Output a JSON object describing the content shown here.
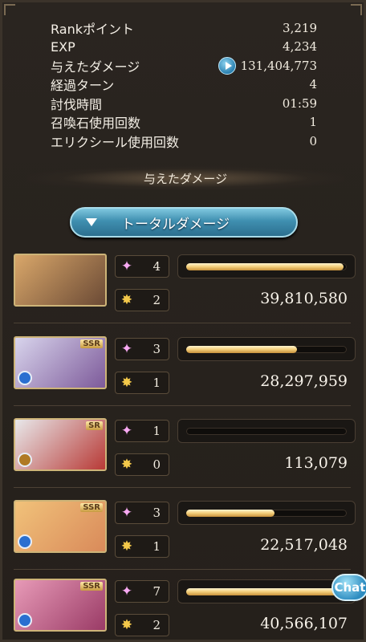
{
  "stats": [
    {
      "label": "Rankポイント",
      "value": "3,219"
    },
    {
      "label": "EXP",
      "value": "4,234"
    },
    {
      "label": "与えたダメージ",
      "value": "131,404,773",
      "has_button": true
    },
    {
      "label": "経過ターン",
      "value": "4"
    },
    {
      "label": "討伐時間",
      "value": "01:59"
    },
    {
      "label": "召喚石使用回数",
      "value": "1"
    },
    {
      "label": "エリクシール使用回数",
      "value": "0"
    }
  ],
  "section_title": "与えたダメージ",
  "dropdown_label": "トータルダメージ",
  "characters": [
    {
      "skill_count": "4",
      "hit_count": "2",
      "damage": "39,810,580",
      "bar_fraction": 0.98,
      "rarity": "",
      "element_color": "",
      "portrait_colors": [
        "#d9a76a",
        "#6b4a35"
      ]
    },
    {
      "skill_count": "3",
      "hit_count": "1",
      "damage": "28,297,959",
      "bar_fraction": 0.69,
      "rarity": "SSR",
      "element_color": "#2a6fd0",
      "portrait_colors": [
        "#d8d4ec",
        "#7d5a9a"
      ]
    },
    {
      "skill_count": "1",
      "hit_count": "0",
      "damage": "113,079",
      "bar_fraction": 0.0,
      "rarity": "SR",
      "element_color": "#b07a25",
      "portrait_colors": [
        "#e8e8ea",
        "#b83a36"
      ]
    },
    {
      "skill_count": "3",
      "hit_count": "1",
      "damage": "22,517,048",
      "bar_fraction": 0.55,
      "rarity": "SSR",
      "element_color": "#2a6fd0",
      "portrait_colors": [
        "#f1c27a",
        "#d98a5a"
      ]
    },
    {
      "skill_count": "7",
      "hit_count": "2",
      "damage": "40,566,107",
      "bar_fraction": 1.0,
      "rarity": "SSR",
      "element_color": "#2a6fd0",
      "portrait_colors": [
        "#e79ab7",
        "#9a3b66"
      ]
    }
  ],
  "chat_label": "Chat",
  "icons": {
    "skill": "sparkle-icon",
    "hit": "chain-burst-icon",
    "play": "play-icon",
    "dropdown": "triangle-down-icon"
  }
}
